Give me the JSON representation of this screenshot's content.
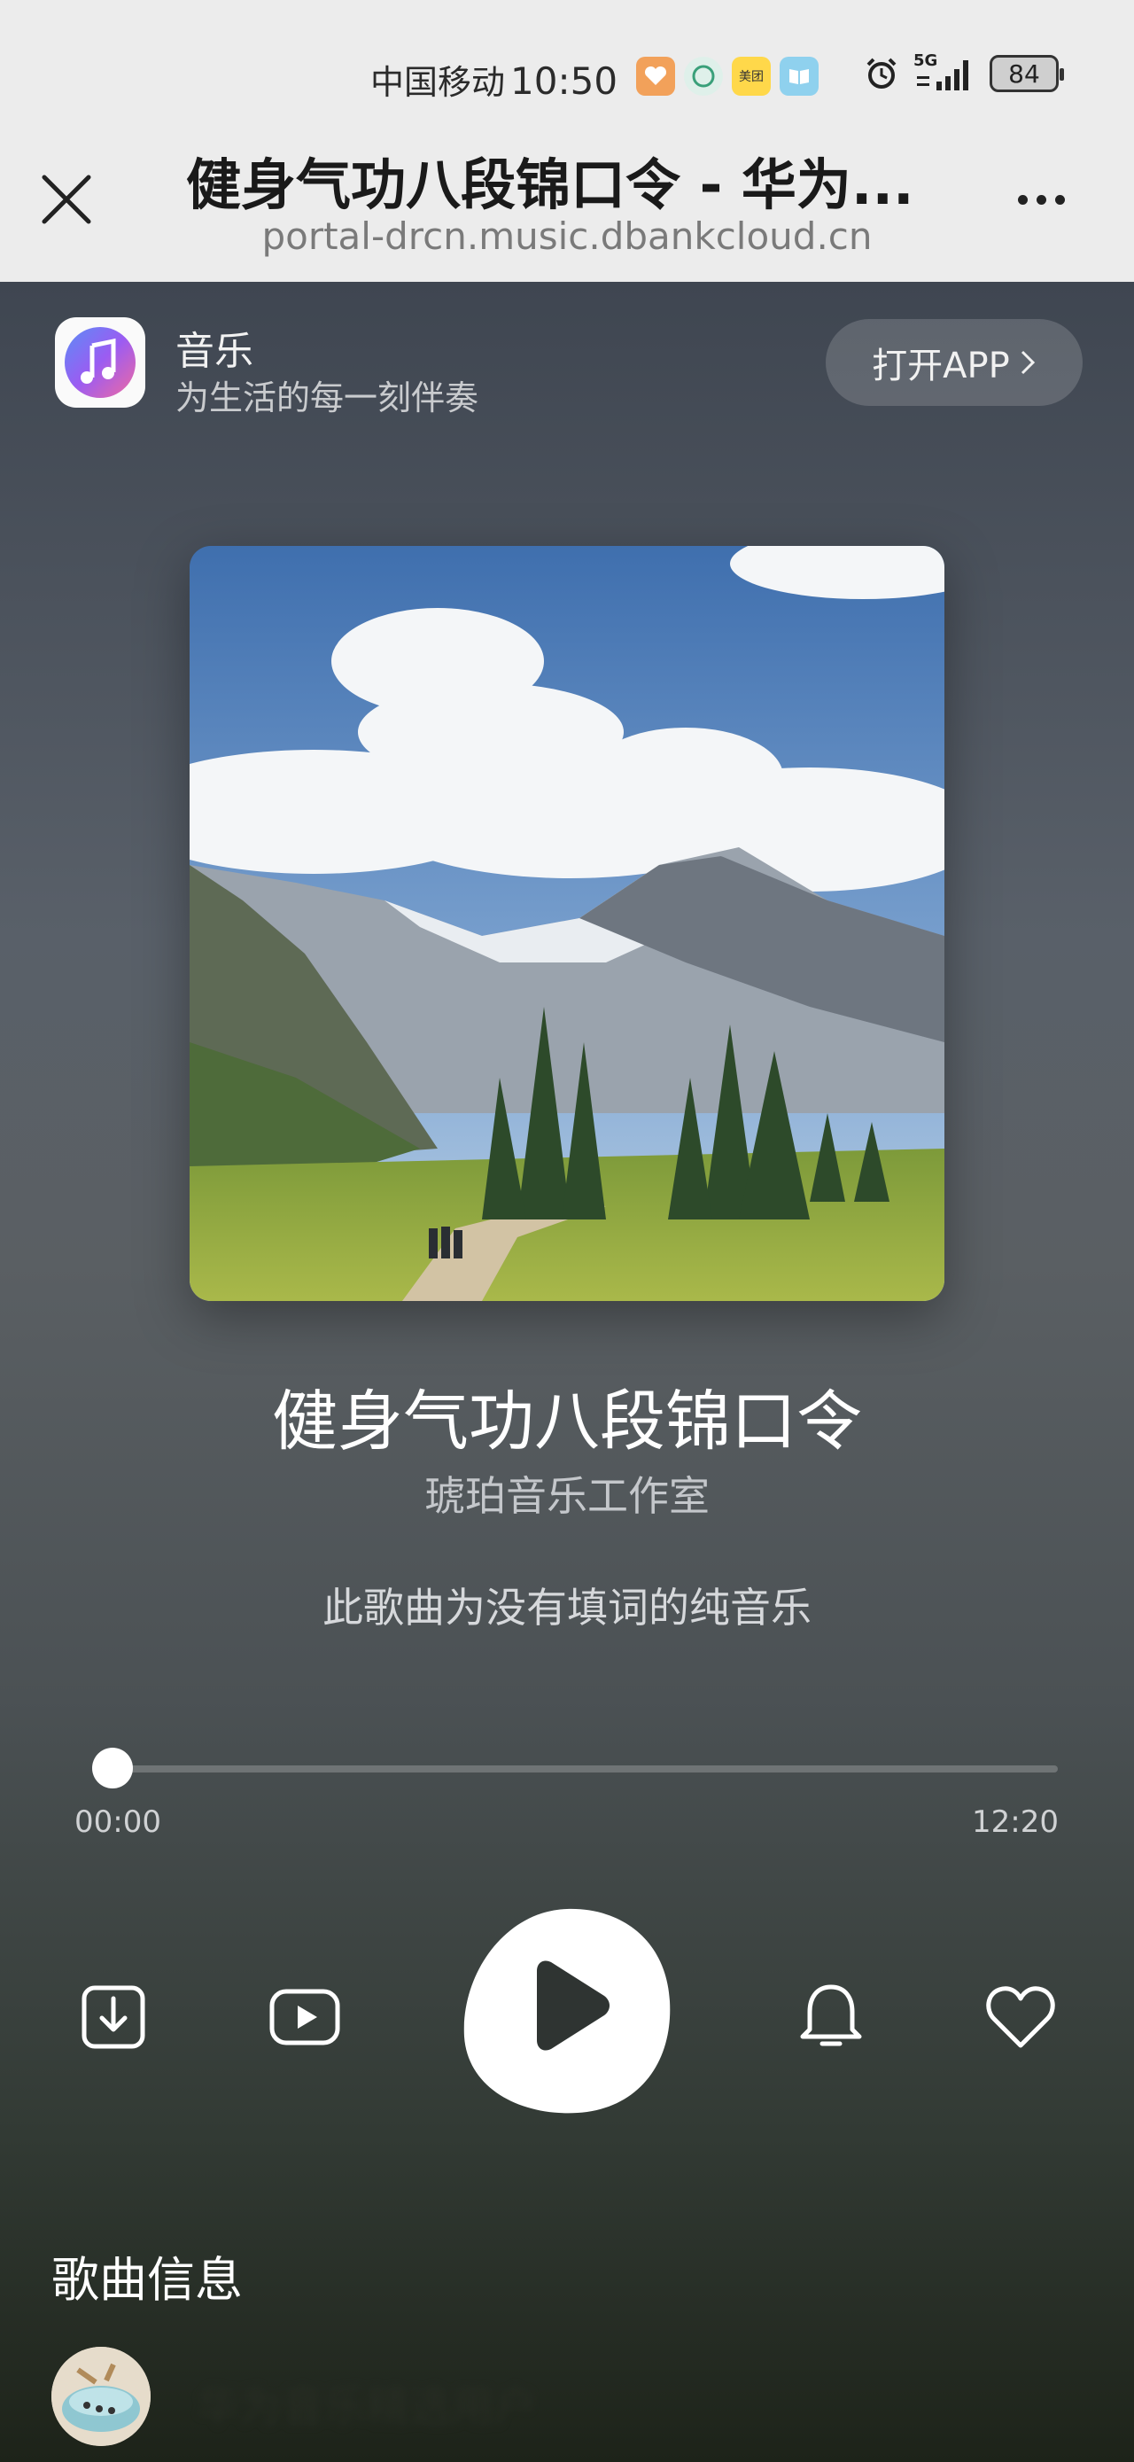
{
  "status_bar": {
    "carrier": "中国移动",
    "time": "10:50",
    "app_badges": [
      "favorites-app",
      "mobile-app",
      "美团",
      "reader-app"
    ],
    "network": "5G",
    "battery": "84"
  },
  "browser": {
    "title": "健身气功八段锦口令 - 华为...",
    "url": "portal-drcn.music.dbankcloud.cn"
  },
  "app_banner": {
    "name": "音乐",
    "slogan": "为生活的每一刻伴奏",
    "open_button": "打开APP"
  },
  "song": {
    "title": "健身气功八段锦口令",
    "artist": "琥珀音乐工作室",
    "lyrics_note": "此歌曲为没有填词的纯音乐"
  },
  "playback": {
    "current_time": "00:00",
    "total_time": "12:20",
    "progress_fraction": 0
  },
  "controls": {
    "icons": [
      "download-icon",
      "video-icon",
      "play-icon",
      "bell-icon",
      "heart-icon"
    ]
  },
  "song_info": {
    "heading": "歌曲信息",
    "uploader_name": "华为音乐精选用户"
  },
  "colors": {
    "header_bg": "#ececec",
    "accent": "#ffffff"
  }
}
